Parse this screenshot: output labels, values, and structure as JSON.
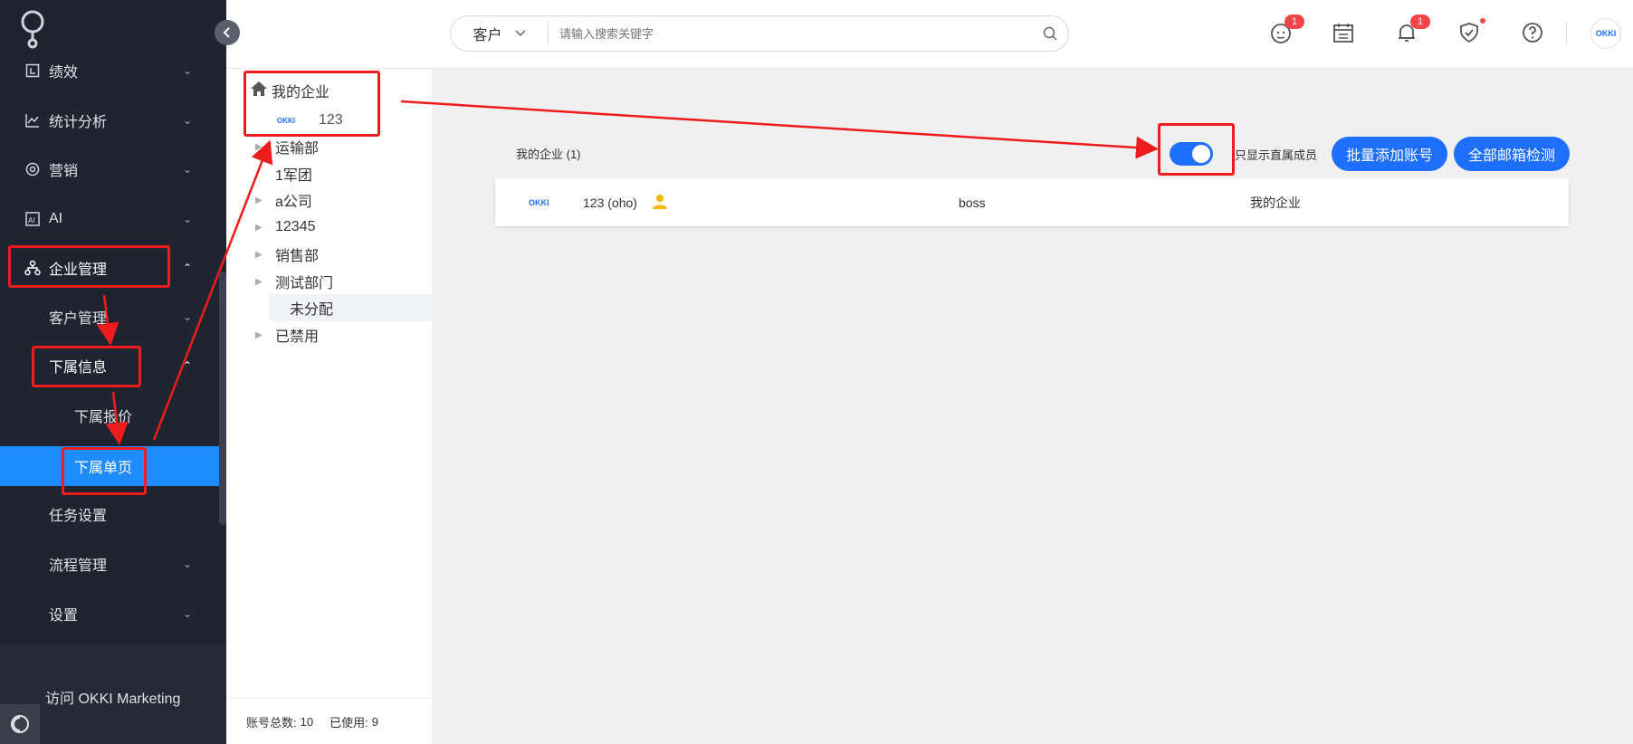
{
  "sidebar": {
    "items": [
      {
        "label": "绩效",
        "icon": "chart-square-icon",
        "chevron": "down"
      },
      {
        "label": "统计分析",
        "icon": "line-chart-icon",
        "chevron": "down"
      },
      {
        "label": "营销",
        "icon": "target-icon",
        "chevron": "down"
      },
      {
        "label": "AI",
        "icon": "ai-icon",
        "chevron": "down"
      },
      {
        "label": "企业管理",
        "icon": "org-tree-icon",
        "chevron": "up"
      },
      {
        "label": "客户管理",
        "chevron": "down"
      },
      {
        "label": "下属信息",
        "chevron": "up"
      },
      {
        "label": "下属报价"
      },
      {
        "label": "下属单页"
      },
      {
        "label": "任务设置"
      },
      {
        "label": "流程管理",
        "chevron": "down"
      },
      {
        "label": "设置",
        "chevron": "down"
      }
    ],
    "visit_link": "访问 OKKI Marketing"
  },
  "topbar": {
    "search_scope": "客户",
    "search_placeholder": "请输入搜索关键字",
    "badges": {
      "timer": "1",
      "bell": "1"
    },
    "avatar_text": "OKKI"
  },
  "tree": {
    "root": "我的企业",
    "org": {
      "logo": "OKKI",
      "label": "123"
    },
    "nodes": [
      {
        "label": "运输部",
        "expandable": true
      },
      {
        "label": "1军团",
        "expandable": false
      },
      {
        "label": "a公司",
        "expandable": true
      },
      {
        "label": "12345",
        "expandable": true
      },
      {
        "label": "销售部",
        "expandable": true
      },
      {
        "label": "测试部门",
        "expandable": true
      },
      {
        "label": "未分配",
        "expandable": false,
        "selected": true
      },
      {
        "label": "已禁用",
        "expandable": true
      }
    ],
    "footer": {
      "total_label": "账号总数:",
      "total_value": "10",
      "used_label": "已使用:",
      "used_value": "9"
    }
  },
  "main": {
    "header": "我的企业 (1)",
    "toggle_on": true,
    "toggle_label": "只显示直属成员",
    "btn_add": "批量添加账号",
    "btn_check": "全部邮箱检测",
    "members": [
      {
        "logo": "OKKI",
        "name": "123 (oho)",
        "role": "boss",
        "dept": "我的企业"
      }
    ]
  },
  "colors": {
    "sidebar_bg": "#1f2430",
    "accent": "#1e6fff",
    "active_menu": "#1e8cff",
    "badge": "#f5454a",
    "annotation": "#ee1c1c"
  }
}
